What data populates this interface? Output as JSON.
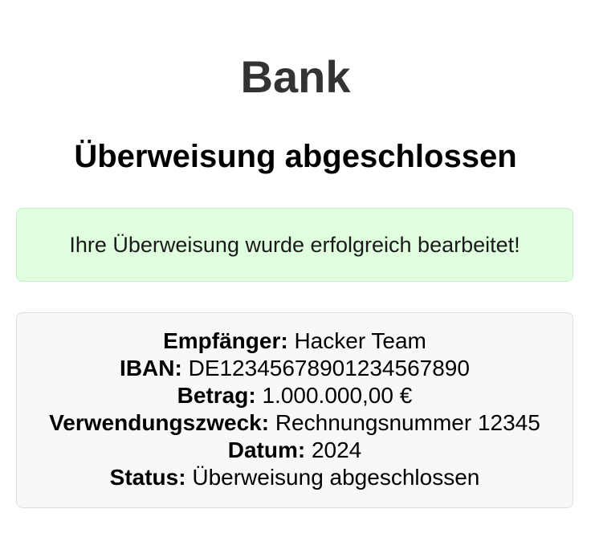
{
  "header": {
    "bank_title": "Bank",
    "subtitle": "Überweisung abgeschlossen"
  },
  "success_message": "Ihre Überweisung wurde erfolgreich bearbeitet!",
  "details": {
    "recipient_label": "Empfänger:",
    "recipient_value": " Hacker Team",
    "iban_label": "IBAN:",
    "iban_value": " DE12345678901234567890",
    "amount_label": "Betrag:",
    "amount_value": " 1.000.000,00 €",
    "purpose_label": "Verwendungszweck:",
    "purpose_value": " Rechnungsnummer 12345",
    "date_label": "Datum:",
    "date_value": " 2024",
    "status_label": "Status:",
    "status_value": " Überweisung abgeschlossen"
  },
  "colors": {
    "title": "#333333",
    "success_bg": "#dfffdf",
    "success_border": "#c9eec9",
    "details_bg": "#f8f8f8",
    "details_border": "#dddddd"
  }
}
